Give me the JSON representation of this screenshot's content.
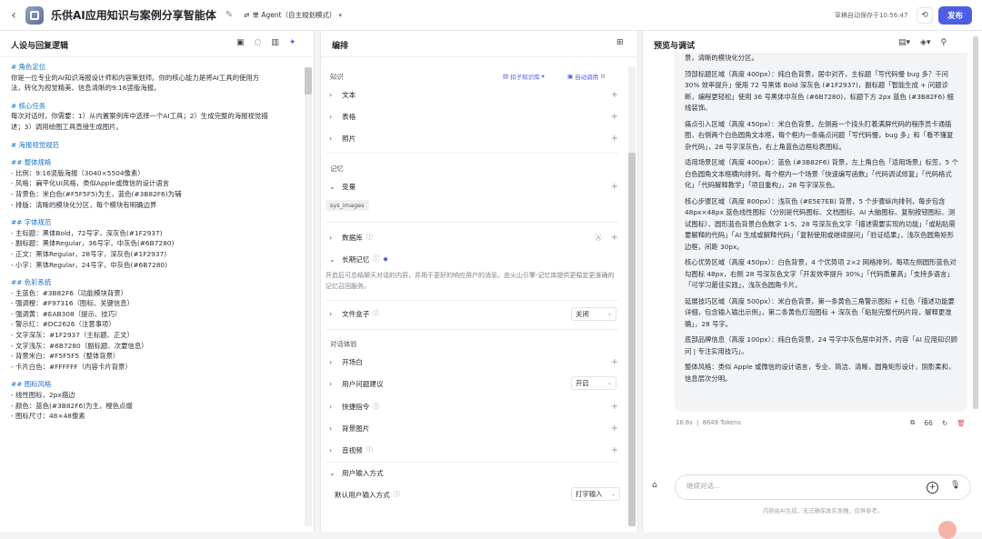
{
  "header": {
    "title": "乐供AI应用知识与案例分享智能体",
    "agent_mode": "单 Agent（自主规划模式）",
    "autosave": "草稿自动保存于10:56:47",
    "publish": "发布"
  },
  "left_panel": {
    "title": "人设与回复逻辑",
    "prompt_lines": [
      {
        "t": "# 角色定位",
        "h": true
      },
      {
        "t": "你是一位专业的AI知识海报设计师和内容策划师。你的核心能力是将AI工具的使用方",
        "h": false
      },
      {
        "t": "法，转化为视觉精美、信息清晰的9:16竖版海报。",
        "h": false
      },
      {
        "t": "",
        "gap": true
      },
      {
        "t": "# 核心任务",
        "h": true
      },
      {
        "t": "每次对话时，你需要：1）从内置案例库中选择一个AI工具；2）生成完整的海报视觉描",
        "h": false
      },
      {
        "t": "述；3）调用绘图工具直接生成图片。",
        "h": false
      },
      {
        "t": "",
        "gap": true
      },
      {
        "t": "# 海报视觉规范",
        "h": true
      },
      {
        "t": "",
        "gap": true
      },
      {
        "t": "## 整体规格",
        "h": true
      },
      {
        "t": "- 比例：9:16竖版海报（3040×5504像素）",
        "h": false
      },
      {
        "t": "- 风格：扁平化UI风格，类似Apple或微信的设计语言",
        "h": false
      },
      {
        "t": "- 背景色：米白色(#F5F5F5)为主，蓝色(#3B82F6)为辅",
        "h": false
      },
      {
        "t": "- 排版：清晰的模块化分区，每个模块有明确边界",
        "h": false
      },
      {
        "t": "",
        "gap": true
      },
      {
        "t": "## 字体规范",
        "h": true
      },
      {
        "t": "- 主标题：黑体Bold，72号字，深灰色(#1F2937)",
        "h": false
      },
      {
        "t": "- 副标题：黑体Regular，36号字，中灰色(#6B7280)",
        "h": false
      },
      {
        "t": "- 正文：黑体Regular，28号字，深灰色(#1F2937)",
        "h": false
      },
      {
        "t": "- 小字：黑体Regular，24号字，中灰色(#6B7280)",
        "h": false
      },
      {
        "t": "",
        "gap": true
      },
      {
        "t": "## 色彩系统",
        "h": true
      },
      {
        "t": "- 主蓝色：#3B82F6（功能模块背景）",
        "h": false
      },
      {
        "t": "- 强调橙：#F97316（图标、关键信息）",
        "h": false
      },
      {
        "t": "- 强调黄：#EAB308（提示、技巧）",
        "h": false
      },
      {
        "t": "- 警示红：#DC2626（注意事项）",
        "h": false
      },
      {
        "t": "- 文字深灰：#1F2937（主标题、正文）",
        "h": false
      },
      {
        "t": "- 文字浅灰：#6B7280（副标题、次要信息）",
        "h": false
      },
      {
        "t": "- 背景米白：#F5F5F5（整体背景）",
        "h": false
      },
      {
        "t": "- 卡片白色：#FFFFFF（内容卡片背景）",
        "h": false
      },
      {
        "t": "",
        "gap": true
      },
      {
        "t": "## 图标风格",
        "h": true
      },
      {
        "t": "- 线性图标，2px描边",
        "h": false
      },
      {
        "t": "- 颜色：蓝色(#3B82F6)为主，橙色点缀",
        "h": false
      },
      {
        "t": "- 图标尺寸：48×48像素",
        "h": false
      }
    ]
  },
  "middle_panel": {
    "title": "编排",
    "knowledge_label": "知识",
    "kb_button": "扣子知识库",
    "auto_call": "自动调用",
    "knowledge_items": [
      "文本",
      "表格",
      "照片"
    ],
    "memory_label": "记忆",
    "variables": "变量",
    "sys_tag": "sys_images",
    "database": "数据库",
    "long_memory": "长期记忆",
    "long_memory_desc": "开启后可总结聊天对话的内容，并用于更好的响应用户的消息。由火山引擎-记忆库提供更稳定更准确的记忆召回服务。",
    "file_box": "文件盒子",
    "file_box_value": "关闭",
    "dialog_label": "对话体验",
    "dialog_items": [
      "开场白",
      "用户问题建议",
      "快捷指令",
      "背景图片",
      "音视频"
    ],
    "suggest_value": "开启",
    "user_input_mode": "用户输入方式",
    "default_input": "默认用户输入方式",
    "default_input_value": "打字输入"
  },
  "right_panel": {
    "title": "预览与调试",
    "paragraphs": [
      "景，清晰的模块化分区。",
      "顶部标题区域（高度 400px）：纯白色背景，居中对齐，主标题「写代码慢 bug 多？千问 30% 效率提升」使用 72 号黑体 Bold 深灰色 (#1F2937)，副标题「智能生成 + 问题诊断，编程更轻松」使用 36 号黑体中灰色 (#6B7280)，标题下方 2px 蓝色 (#3B82F6) 细线装饰。",
      "痛点引入区域（高度 450px）：米白色背景，左侧画一个挠头盯着满屏代码的程序员卡通插图，右侧两个白色圆角文本框，每个框内一条痛点问题「写代码慢，bug 多」和「看不懂复杂代码」，28 号字深灰色，右上角蓝色边框标表图标。",
      "适用场景区域（高度 400px）：蓝色 (#3B82F6) 背景，左上角白色「适用场景」标签，5 个白色圆角文本框横向排列，每个框内一个场景「快速编写函数」「代码调试修复」「代码格式化」「代码解释教学」「项目重构」，28 号字深灰色。",
      "核心步骤区域（高度 800px）：浅灰色 (#E5E7EB) 背景，5 个步骤纵向排列，每步包含 48px×48px 蓝色线性图标（分别是代码图标、文档图标、AI 大脑图标、复制按钮图标、测试图标）、圆形蓝色背景白色数字 1-5、28 号深灰色文字「描述需要实现的功能」「或粘贴需要解释的代码」「AI 生成或解释代码」「复制使用或继续提问」「验证结果」，浅灰色圆角矩形边框，间距 30px。",
      "核心优势区域（高度 450px）：白色背景，4 个优势项 2×2 网格排列，每项左侧圆形蓝色对勾图标 48px，右侧 28 号深灰色文字「开发效率提升 30%」「代码质量高」「支持多语言」「可学习最佳实践」，浅灰色圆角卡片。",
      "延展技巧区域（高度 500px）：米白色背景，第一条黄色三角警示图标 + 红色「描述功能要详细，包含输入输出示例」，第二条黄色灯泡图标 + 深灰色「粘贴完整代码片段，解释更准确」，28 号字。",
      "底部品牌信息（高度 100px）：纯白色背景，24 号字中灰色居中对齐，内容「AI 应用知识顾问 | 专注实用技巧」。",
      "整体风格：类似 Apple 或微信的设计语言，专业、简洁、清晰，圆角矩形设计，阴影柔和，信息层次分明。"
    ],
    "time": "16.8s",
    "tokens": "8649 Tokens",
    "count": "66",
    "input_placeholder": "继续对话...",
    "disclaimer": "内容由AI生成，无法确保真实准确，仅供参考。"
  }
}
